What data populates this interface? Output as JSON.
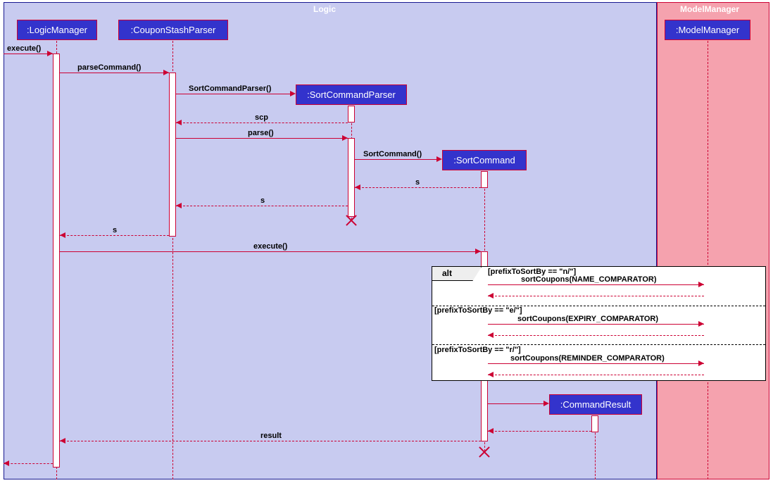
{
  "frames": {
    "logic": "Logic",
    "modelmgr": "ModelManager"
  },
  "participants": {
    "logicManager": ":LogicManager",
    "couponStashParser": ":CouponStashParser",
    "sortCommandParser": ":SortCommandParser",
    "sortCommand": ":SortCommand",
    "commandResult": ":CommandResult",
    "modelManager": ":ModelManager"
  },
  "messages": {
    "execute1": "execute()",
    "parseCommand": "parseCommand()",
    "sortCommandParserCtor": "SortCommandParser()",
    "scp": "scp",
    "parse": "parse()",
    "sortCommandCtor": "SortCommand()",
    "s1": "s",
    "s2": "s",
    "s3": "s",
    "execute2": "execute()",
    "sortCouponsName": "sortCoupons(NAME_COMPARATOR)",
    "sortCouponsExpiry": "sortCoupons(EXPIRY_COMPARATOR)",
    "sortCouponsReminder": "sortCoupons(REMINDER_COMPARATOR)",
    "result": "result"
  },
  "alt": {
    "label": "alt",
    "guard1": "[prefixToSortBy == \"n/\"]",
    "guard2": "[prefixToSortBy == \"e/\"]",
    "guard3": "[prefixToSortBy == \"r/\"]"
  }
}
